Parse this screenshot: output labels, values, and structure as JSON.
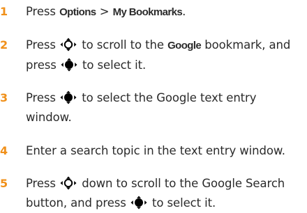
{
  "accent_color": "#f0901a",
  "icons": {
    "nav_key": "navigation-key-icon",
    "center_key": "center-select-key-icon"
  },
  "steps": [
    {
      "number": "1",
      "segments": [
        "Press ",
        "Options",
        " > ",
        "My Bookmarks",
        "."
      ]
    },
    {
      "number": "2",
      "segments": [
        "Press ",
        " to scroll to the ",
        "Google",
        " bookmark, and",
        "press ",
        " to select it."
      ]
    },
    {
      "number": "3",
      "segments": [
        "Press ",
        " to select the Google text entry",
        "window."
      ]
    },
    {
      "number": "4",
      "segments": [
        "Enter a search topic in the text entry window."
      ]
    },
    {
      "number": "5",
      "segments": [
        "Press ",
        " down to scroll to the Google Search",
        "button, and press ",
        " to select it."
      ]
    }
  ]
}
